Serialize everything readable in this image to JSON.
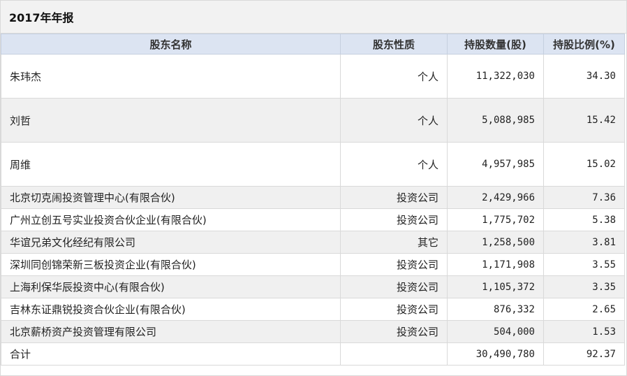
{
  "title": "2017年年报",
  "columns": [
    "股东名称",
    "股东性质",
    "持股数量(股)",
    "持股比例(%)"
  ],
  "rows": [
    {
      "name": "朱玮杰",
      "nature": "个人",
      "shares": "11,322,030",
      "ratio": "34.30"
    },
    {
      "name": "刘哲",
      "nature": "个人",
      "shares": "5,088,985",
      "ratio": "15.42"
    },
    {
      "name": "周维",
      "nature": "个人",
      "shares": "4,957,985",
      "ratio": "15.02"
    },
    {
      "name": "北京切克闹投资管理中心(有限合伙)",
      "nature": "投资公司",
      "shares": "2,429,966",
      "ratio": "7.36"
    },
    {
      "name": "广州立创五号实业投资合伙企业(有限合伙)",
      "nature": "投资公司",
      "shares": "1,775,702",
      "ratio": "5.38"
    },
    {
      "name": "华谊兄弟文化经纪有限公司",
      "nature": "其它",
      "shares": "1,258,500",
      "ratio": "3.81"
    },
    {
      "name": "深圳同创锦荣新三板投资企业(有限合伙)",
      "nature": "投资公司",
      "shares": "1,171,908",
      "ratio": "3.55"
    },
    {
      "name": "上海利保华辰投资中心(有限合伙)",
      "nature": "投资公司",
      "shares": "1,105,372",
      "ratio": "3.35"
    },
    {
      "name": "吉林东证鼎锐投资合伙企业(有限合伙)",
      "nature": "投资公司",
      "shares": "876,332",
      "ratio": "2.65"
    },
    {
      "name": "北京薪桥资产投资管理有限公司",
      "nature": "投资公司",
      "shares": "504,000",
      "ratio": "1.53"
    }
  ],
  "total": {
    "name": "合计",
    "nature": "",
    "shares": "30,490,780",
    "ratio": "92.37"
  }
}
